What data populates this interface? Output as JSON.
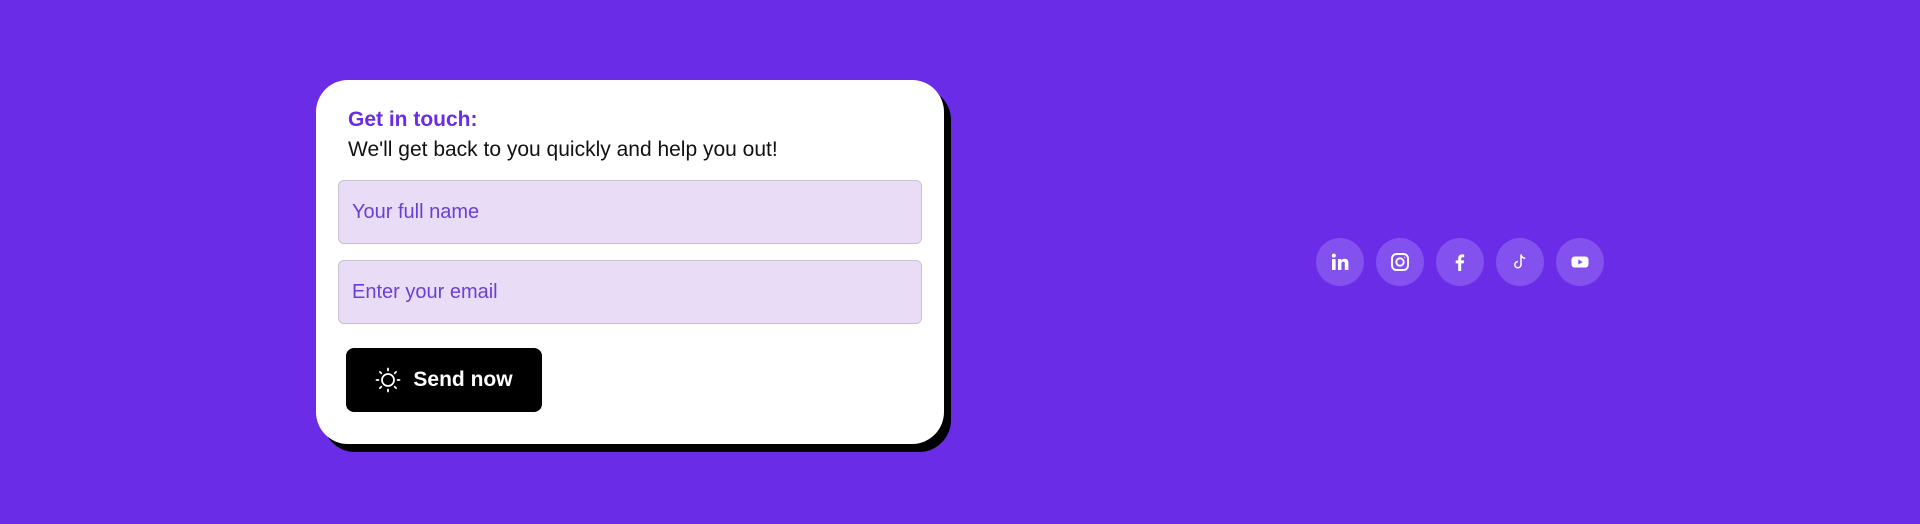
{
  "contact": {
    "title": "Get in touch:",
    "subtitle": "We'll get back to you quickly and help you out!",
    "name_placeholder": "Your full name",
    "email_placeholder": "Enter your email",
    "send_label": "Send now",
    "send_icon": "sun-icon"
  },
  "socials": [
    {
      "icon": "linkedin-icon"
    },
    {
      "icon": "instagram-icon"
    },
    {
      "icon": "facebook-icon"
    },
    {
      "icon": "tiktok-icon"
    },
    {
      "icon": "youtube-icon"
    }
  ],
  "colors": {
    "background": "#6b2ce8",
    "card": "#ffffff",
    "accent": "#6b2ce8",
    "field_bg": "#e9dcf6",
    "button": "#000000",
    "social_bg": "#8352ee"
  }
}
